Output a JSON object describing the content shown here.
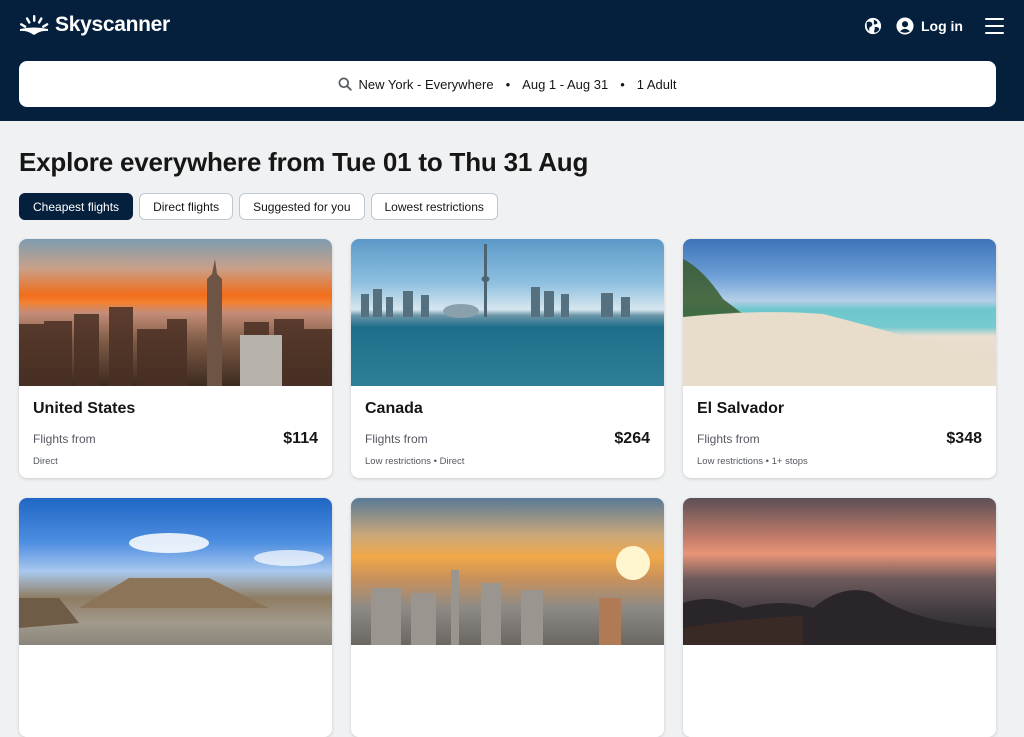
{
  "header": {
    "brand": "Skyscanner",
    "login_label": "Log in",
    "icons": {
      "logo": "skyscanner-sun-logo",
      "globe": "globe-icon",
      "account": "user-circle-icon",
      "menu": "hamburger-menu-icon"
    }
  },
  "search": {
    "icon": "search-icon",
    "route": "New York - Everywhere",
    "dates": "Aug 1 - Aug 31",
    "travellers": "1 Adult",
    "separator": "•"
  },
  "page": {
    "title": "Explore everywhere from Tue 01 to Thu 31 Aug"
  },
  "filters": [
    {
      "label": "Cheapest flights",
      "active": true
    },
    {
      "label": "Direct flights",
      "active": false
    },
    {
      "label": "Suggested for you",
      "active": false
    },
    {
      "label": "Lowest restrictions",
      "active": false
    }
  ],
  "destinations": [
    {
      "name": "United States",
      "from_label": "Flights from",
      "price": "$114",
      "tags": "Direct"
    },
    {
      "name": "Canada",
      "from_label": "Flights from",
      "price": "$264",
      "tags": "Low restrictions • Direct"
    },
    {
      "name": "El Salvador",
      "from_label": "Flights from",
      "price": "$348",
      "tags": "Low restrictions • 1+ stops"
    },
    {
      "name": "",
      "from_label": "",
      "price": "",
      "tags": ""
    },
    {
      "name": "",
      "from_label": "",
      "price": "",
      "tags": ""
    },
    {
      "name": "",
      "from_label": "",
      "price": "",
      "tags": ""
    }
  ],
  "colors": {
    "header_bg": "#05203c",
    "page_bg": "#eff1f2",
    "active_chip": "#05203c"
  }
}
